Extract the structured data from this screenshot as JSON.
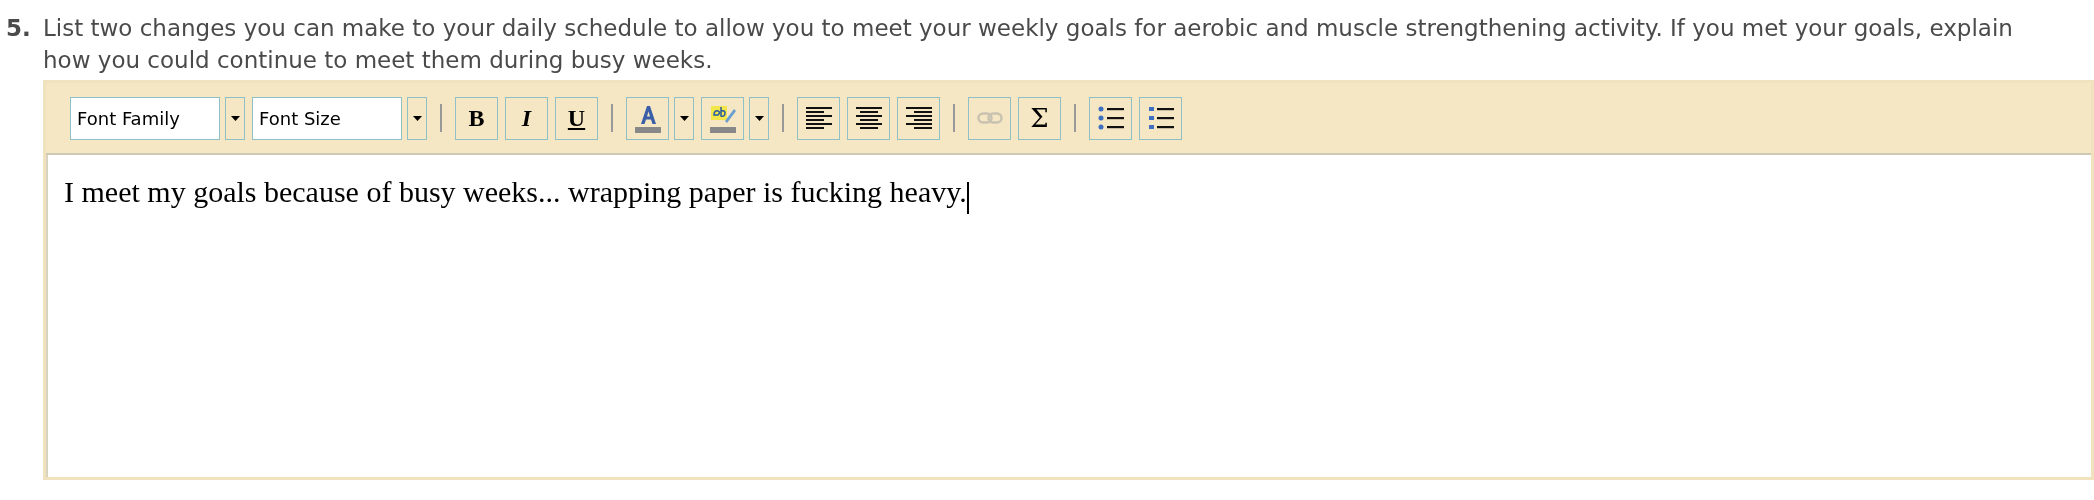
{
  "question": {
    "number": "5.",
    "text": "List two changes you can make to your daily schedule to allow you to meet your weekly goals for aerobic and muscle strengthening activity. If you met your goals, explain how you could continue to meet them during busy weeks."
  },
  "editor": {
    "toolbar": [
      {
        "kind": "select",
        "label": "Font Family"
      },
      {
        "kind": "select",
        "label": "Font Size"
      },
      {
        "kind": "separator"
      },
      {
        "kind": "bold-button",
        "label": "B"
      },
      {
        "kind": "italic-button",
        "label": "I"
      },
      {
        "kind": "underline-button",
        "label": "U"
      },
      {
        "kind": "separator"
      },
      {
        "kind": "text-color-split"
      },
      {
        "kind": "highlight-split"
      },
      {
        "kind": "separator"
      },
      {
        "kind": "align-left-button"
      },
      {
        "kind": "align-center-button"
      },
      {
        "kind": "align-right-button"
      },
      {
        "kind": "separator"
      },
      {
        "kind": "link-button",
        "disabled": true
      },
      {
        "kind": "symbol-button",
        "label": "Σ"
      },
      {
        "kind": "separator"
      },
      {
        "kind": "bullet-list-button"
      },
      {
        "kind": "numbered-list-button"
      }
    ],
    "content": "I meet my goals because of busy weeks... wrapping paper is fucking heavy."
  }
}
